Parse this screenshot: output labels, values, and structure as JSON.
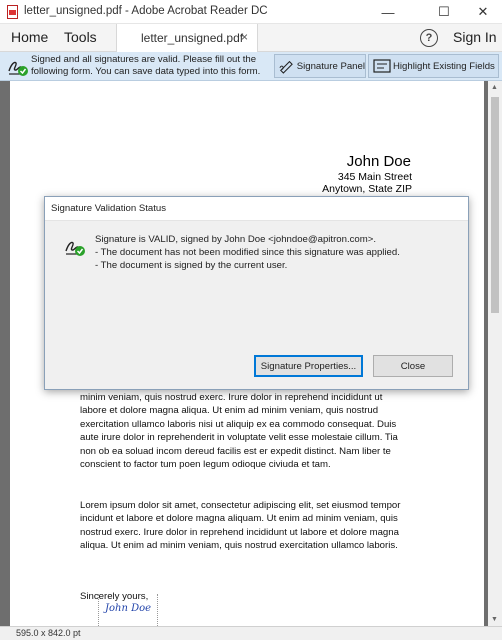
{
  "window": {
    "title": "letter_unsigned.pdf - Adobe Acrobat Reader DC",
    "minimize_glyph": "—",
    "maximize_glyph": "☐",
    "close_glyph": "✕"
  },
  "nav": {
    "home": "Home",
    "tools": "Tools",
    "tab_label": "letter_unsigned.pdf",
    "tab_close": "×",
    "help_glyph": "?",
    "sign_in": "Sign In"
  },
  "notification": {
    "text": "Signed and all signatures are valid.  Please fill out the following form. You can save data typed into this form.",
    "signature_panel": "Signature Panel",
    "highlight_fields": "Highlight Existing Fields"
  },
  "document": {
    "sender": {
      "name": "John Doe",
      "street": "345 Main Street",
      "city": "Anytown, State ZIP"
    },
    "paragraph1": "minim veniam, quis nostrud exerc. Irure dolor in reprehend incididunt ut labore et dolore magna aliqua. Ut enim ad minim veniam, quis nostrud exercitation ullamco laboris nisi ut aliquip ex ea commodo consequat. Duis aute irure dolor in reprehenderit in voluptate velit esse molestaie cillum. Tia non ob ea soluad incom dereud facilis est er expedit distinct. Nam liber te conscient to factor tum poen legum odioque civiuda et tam.",
    "paragraph2": "Lorem ipsum dolor sit amet, consectetur adipiscing elit, set eiusmod tempor incidunt et labore et dolore magna aliquam. Ut enim ad minim veniam, quis nostrud exerc. Irure dolor in reprehend incididunt ut labore et dolore magna aliqua. Ut enim ad minim veniam, quis nostrud exercitation ullamco laboris.",
    "closing": "Sincerely yours,",
    "signature": "John Doe"
  },
  "scrollbar": {
    "up_glyph": "▲",
    "down_glyph": "▼"
  },
  "status": {
    "page_size": "595.0 x 842.0 pt"
  },
  "dialog": {
    "title": "Signature Validation Status",
    "line1": "Signature is VALID, signed by John Doe <johndoe@apitron.com>.",
    "line2": "- The document has not been modified since this signature was applied.",
    "line3": "- The document is signed by the current user.",
    "properties_button": "Signature Properties...",
    "close_button": "Close"
  },
  "colors": {
    "notification_bg": "#d9e8f6",
    "valid_check": "#2aa12a",
    "focus_border": "#0078d7"
  }
}
